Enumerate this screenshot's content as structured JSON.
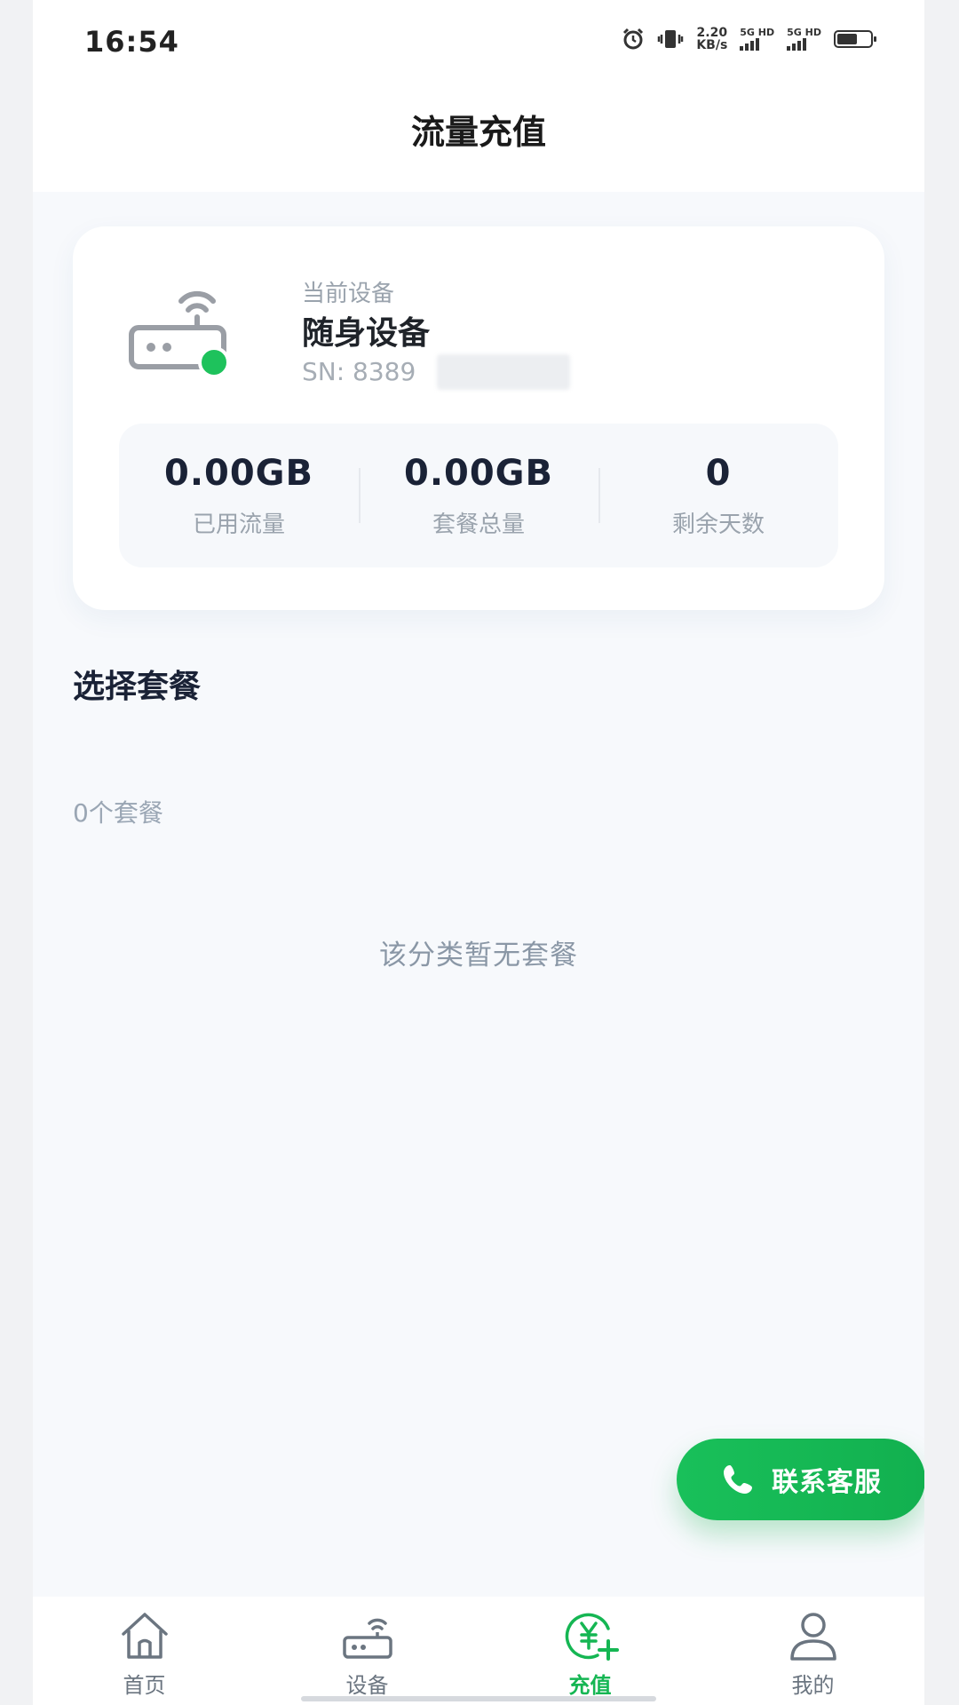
{
  "status_bar": {
    "time": "16:54",
    "net_speed_value": "2.20",
    "net_speed_unit": "KB/s",
    "sim1_label": "5G HD",
    "sim2_label": "5G HD",
    "icons": [
      "alarm-icon",
      "vibrate-icon",
      "battery-icon"
    ]
  },
  "header": {
    "title": "流量充值"
  },
  "device": {
    "label": "当前设备",
    "name": "随身设备",
    "sn": "SN: 8389"
  },
  "stats": [
    {
      "value": "0.00GB",
      "label": "已用流量"
    },
    {
      "value": "0.00GB",
      "label": "套餐总量"
    },
    {
      "value": "0",
      "label": "剩余天数"
    }
  ],
  "packages": {
    "section_title": "选择套餐",
    "count_label": "0个套餐",
    "empty_text": "该分类暂无套餐"
  },
  "support": {
    "label": "联系客服",
    "icon": "phone-icon"
  },
  "bottom_nav": [
    {
      "label": "首页",
      "icon": "home-icon",
      "active": false
    },
    {
      "label": "设备",
      "icon": "router-icon",
      "active": false
    },
    {
      "label": "充值",
      "icon": "yuan-plus-icon",
      "active": true
    },
    {
      "label": "我的",
      "icon": "user-icon",
      "active": false
    }
  ],
  "colors": {
    "accent": "#15b653",
    "online_dot": "#1ec25c",
    "background": "#f7f9fc",
    "text_primary": "#1a2236",
    "text_secondary": "#9aa3ad"
  }
}
